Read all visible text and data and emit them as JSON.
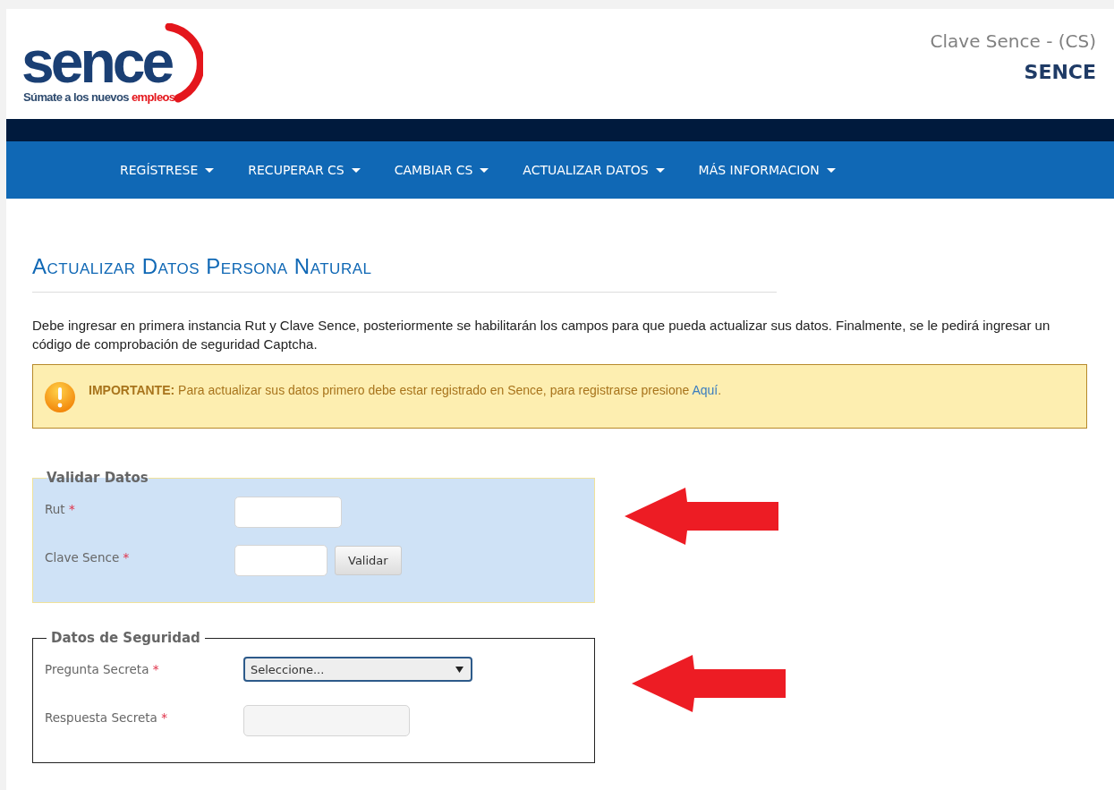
{
  "header": {
    "logo": {
      "wordmark": "sence",
      "tagline": "Súmate a los nuevos",
      "tagline_accent": "empleos"
    },
    "app_title": "Clave Sence - (CS)",
    "org": "SENCE"
  },
  "nav": [
    {
      "label": "REGÍSTRESE",
      "has_menu": true
    },
    {
      "label": "RECUPERAR CS",
      "has_menu": true
    },
    {
      "label": "CAMBIAR CS",
      "has_menu": true
    },
    {
      "label": "ACTUALIZAR DATOS",
      "has_menu": true
    },
    {
      "label": "MÁS INFORMACION",
      "has_menu": true
    }
  ],
  "page_title": "Actualizar Datos Persona Natural",
  "intro": "Debe ingresar en primera instancia Rut y Clave Sence, posteriormente se habilitarán los campos para que pueda actualizar sus datos. Finalmente, se le pedirá ingresar un código de comprobación de seguridad Captcha.",
  "alert": {
    "text": "**IMPORTANTE:** Para actualizar sus datos primero debe estar registrado en Sence, para registrarse presione",
    "link": "Aquí",
    "after": "."
  },
  "fieldsets": [
    {
      "legend": "Validar Datos",
      "highlighted": true,
      "fields": [
        {
          "label": "Rut",
          "required_mark": "*",
          "kind": "text"
        },
        {
          "label": "Clave Sence",
          "required_mark": "*",
          "kind": "text",
          "button": "Validar"
        }
      ]
    },
    {
      "legend": "Datos de Seguridad",
      "highlighted": false,
      "fields": [
        {
          "label": "Pregunta Secreta",
          "required_mark": "*",
          "kind": "select",
          "value": "Seleccione..."
        },
        {
          "label": "Respuesta Secreta",
          "required_mark": "*",
          "kind": "text"
        }
      ]
    }
  ]
}
